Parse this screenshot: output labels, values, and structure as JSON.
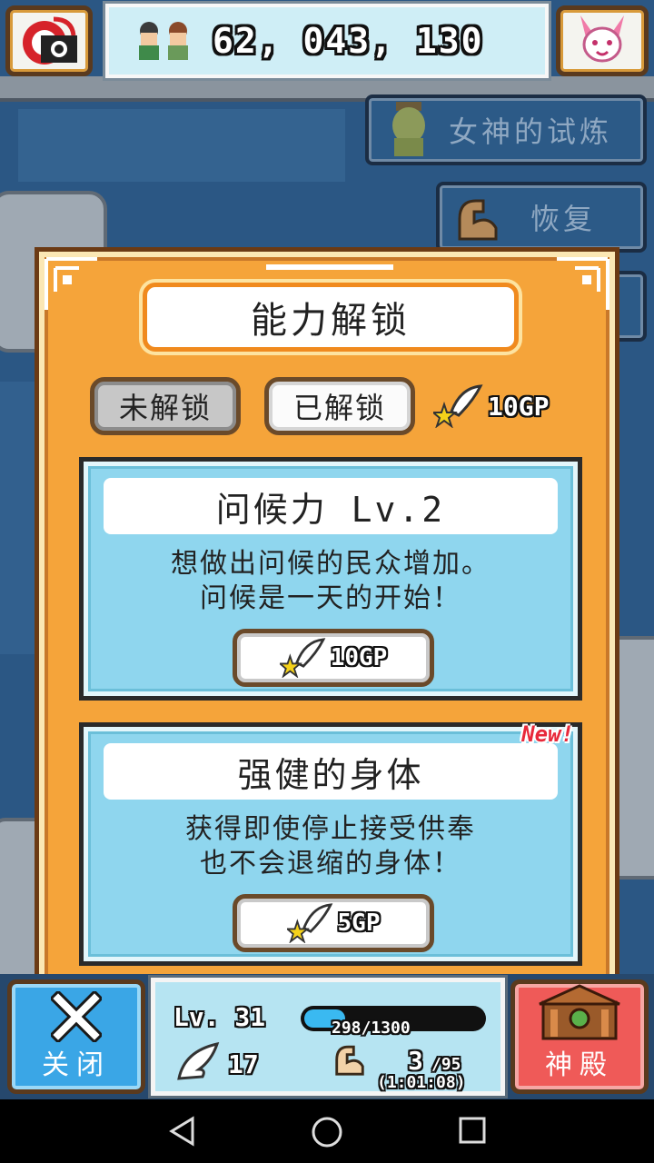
{
  "top_bar": {
    "population": "62, 043, 130",
    "camera_icon": "camera-icon",
    "goddess_icon": "bunny-goddess-icon"
  },
  "side_menu": {
    "items": [
      {
        "label": "女神的试炼",
        "icon": "goddess-statue-icon"
      },
      {
        "label": "恢复",
        "icon": "flexed-arm-icon"
      }
    ]
  },
  "modal": {
    "title": "能力解锁",
    "tabs": [
      {
        "label": "未解锁",
        "selected": false
      },
      {
        "label": "已解锁",
        "selected": true
      }
    ],
    "gp_total": "10GP",
    "abilities": [
      {
        "name": "问候力 Lv.2",
        "description": [
          "想做出问候的民众增加。",
          "问候是一天的开始！"
        ],
        "cost": "10GP",
        "is_new": false
      },
      {
        "name": "强健的身体",
        "description": [
          "获得即使停止接受供奉",
          "也不会退缩的身体！"
        ],
        "cost": "5GP",
        "is_new": true,
        "badge": "New!"
      }
    ]
  },
  "hud": {
    "close_label": "关闭",
    "temple_label": "神殿",
    "level": "Lv. 31",
    "xp": "298/1300",
    "xp_fraction": 0.229,
    "wings": "17",
    "stamina": "3",
    "stamina_max": "/95",
    "timer": "(1:01:08)"
  },
  "colors": {
    "modal_bg": "#f5a43a",
    "card_bg": "#8fd6ee",
    "close_btn": "#3aa6e6",
    "temple_btn": "#ef5a58",
    "new_badge": "#e8283a"
  }
}
